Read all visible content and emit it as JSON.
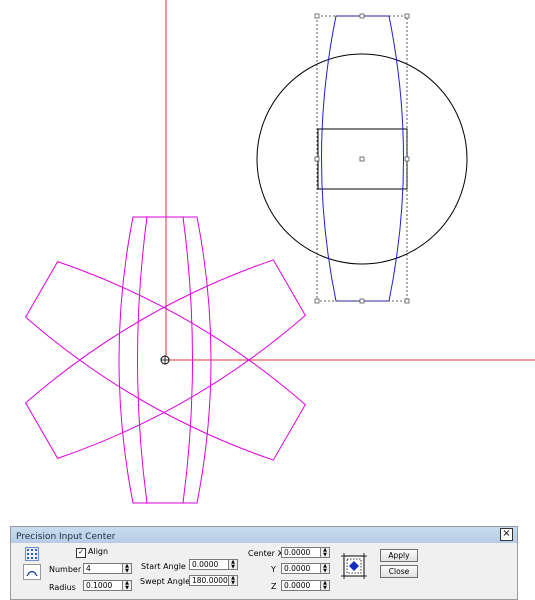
{
  "panel": {
    "title": "Precision Input Center",
    "close": "×",
    "align_label": "Align",
    "align_checked": "✓",
    "number_label": "Number",
    "number_value": "4",
    "radius_label": "Radius",
    "radius_value": "0.1000",
    "start_angle_label": "Start Angle",
    "start_angle_value": "0.0000",
    "swept_angle_label": "Swept Angle",
    "swept_angle_value": "180.0000",
    "center_x_label": "Center X",
    "center_x_value": "0.0000",
    "y_label": "Y",
    "y_value": "0.0000",
    "z_label": "Z",
    "z_value": "0.0000",
    "apply_label": "Apply",
    "close_label": "Close"
  },
  "icons": {
    "pattern": "array-pattern-icon",
    "arc": "arc-icon",
    "origin": "origin-marker-icon",
    "position": "position-picker-icon"
  },
  "colors": {
    "axis": "#e0343c",
    "magenta": "#e000e0",
    "blue": "#2020d0",
    "black": "#000000"
  }
}
